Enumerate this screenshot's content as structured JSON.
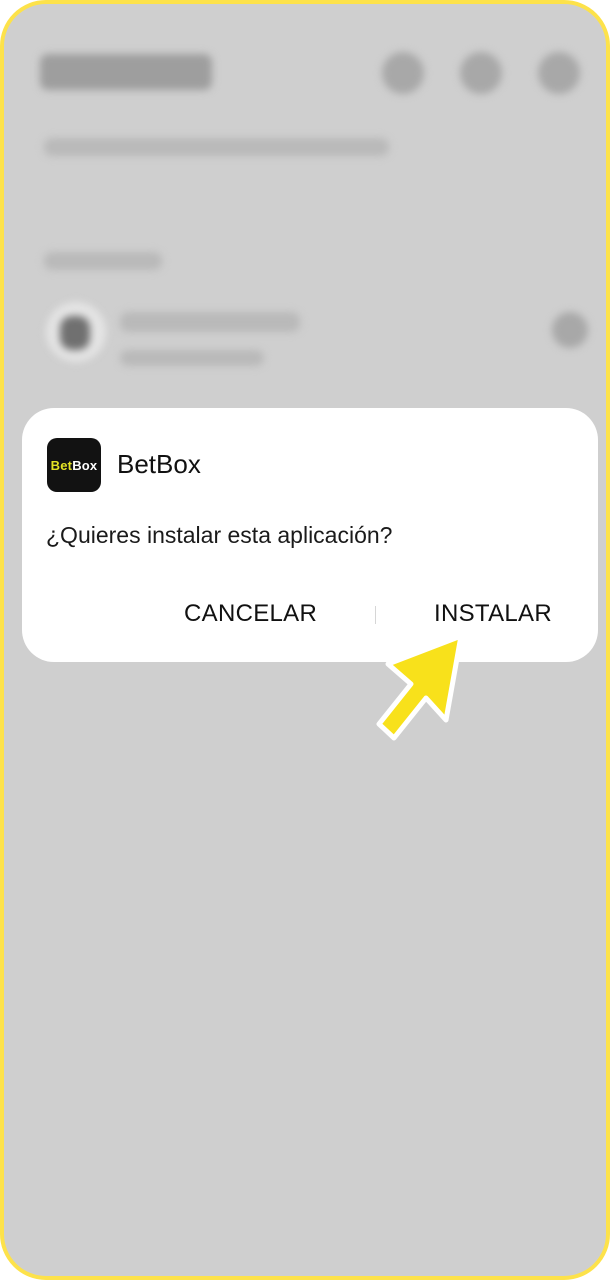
{
  "dialog": {
    "app_icon": {
      "text_bet": "Bet",
      "text_box": "Box",
      "accent_color": "#e3e224",
      "background_color": "#121212"
    },
    "app_name": "BetBox",
    "question": "¿Quieres instalar esta aplicación?",
    "cancel_label": "CANCELAR",
    "install_label": "INSTALAR"
  },
  "colors": {
    "frame_border": "#fde24a",
    "pointer_fill": "#f8e11b",
    "overlay": "#cfcfcf"
  },
  "icons": {
    "pointer": "hand-pointer-arrow-icon"
  }
}
